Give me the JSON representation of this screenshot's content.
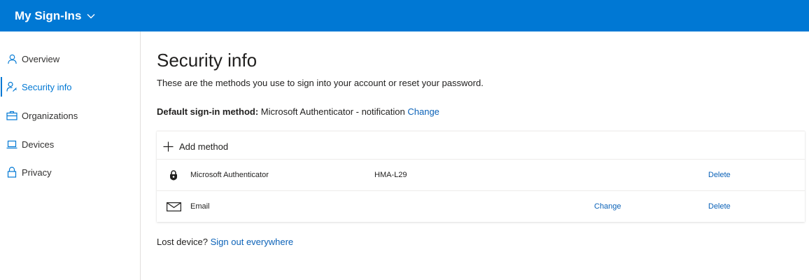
{
  "header": {
    "app_title": "My Sign-Ins",
    "brand_color": "#0078d4"
  },
  "sidebar": {
    "items": [
      {
        "label": "Overview",
        "icon": "person-icon",
        "active": false
      },
      {
        "label": "Security info",
        "icon": "person-key-icon",
        "active": true
      },
      {
        "label": "Organizations",
        "icon": "briefcase-icon",
        "active": false
      },
      {
        "label": "Devices",
        "icon": "laptop-icon",
        "active": false
      },
      {
        "label": "Privacy",
        "icon": "lock-icon",
        "active": false
      }
    ]
  },
  "main": {
    "title": "Security info",
    "description": "These are the methods you use to sign into your account or reset your password.",
    "default_method": {
      "label": "Default sign-in method:",
      "value": "Microsoft Authenticator - notification",
      "change_label": "Change"
    },
    "add_method_label": "Add method",
    "methods": [
      {
        "icon": "authenticator-lock-icon",
        "name": "Microsoft Authenticator",
        "detail": "HMA-L29",
        "change_label": "",
        "delete_label": "Delete"
      },
      {
        "icon": "envelope-icon",
        "name": "Email",
        "detail": "",
        "change_label": "Change",
        "delete_label": "Delete"
      }
    ],
    "lost_device": {
      "text": "Lost device?",
      "link": "Sign out everywhere"
    }
  }
}
